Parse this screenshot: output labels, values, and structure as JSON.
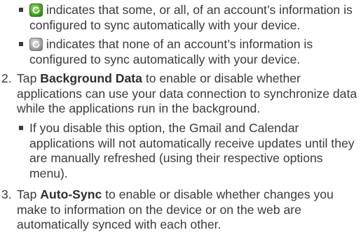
{
  "items": {
    "sync_on": {
      "icon": "sync-active-icon",
      "text": "indicates that some, or all, of an account’s information is configured to sync automatically with your device."
    },
    "sync_off": {
      "icon": "sync-inactive-icon",
      "text": "indicates that none of an account’s information is configured to sync automatically with your device."
    },
    "step2": {
      "number": "2.",
      "lead": "Tap ",
      "bold": "Background Data",
      "rest": " to enable or disable whether applications can use your data connection to synchronize data while the applications run in the background.",
      "bullet": "If you disable this option, the Gmail and Calendar applications will not automatically receive updates until they are manually refreshed (using their respective options menu)."
    },
    "step3": {
      "number": "3.",
      "lead": "Tap ",
      "bold": "Auto-Sync",
      "rest": " to enable or disable whether changes you make to information on the device or on the web are automatically synced with each other."
    }
  },
  "colors": {
    "text": "#3a3a3a",
    "sync_on": "#4ba72c",
    "sync_off": "#a7a7a7"
  }
}
